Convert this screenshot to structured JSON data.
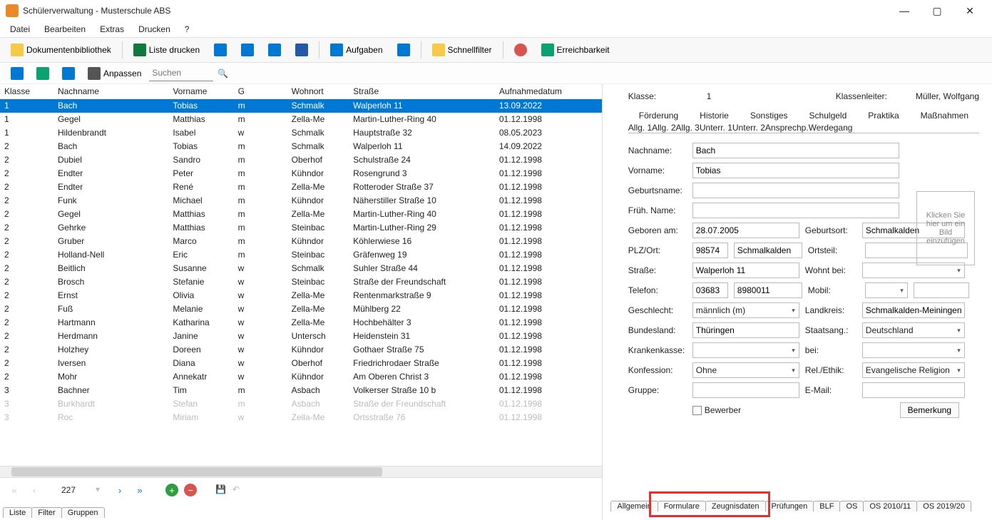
{
  "window": {
    "title": "Schülerverwaltung - Musterschule ABS"
  },
  "menu": [
    "Datei",
    "Bearbeiten",
    "Extras",
    "Drucken",
    "?"
  ],
  "toolbar": {
    "doklib": "Dokumentenbibliothek",
    "listedrucken": "Liste drucken",
    "aufgaben": "Aufgaben",
    "schnellfilter": "Schnellfilter",
    "erreichbarkeit": "Erreichbarkeit"
  },
  "subbar": {
    "anpassen": "Anpassen",
    "search_placeholder": "Suchen"
  },
  "columns": {
    "klasse": "Klasse",
    "nachname": "Nachname",
    "vorname": "Vorname",
    "g": "G",
    "wohnort": "Wohnort",
    "strasse": "Straße",
    "aufnahme": "Aufnahmedatum"
  },
  "rows": [
    {
      "k": "1",
      "n": "Bach",
      "v": "Tobias",
      "g": "m",
      "w": "Schmalk",
      "s": "Walperloh 11",
      "a": "13.09.2022",
      "sel": true
    },
    {
      "k": "1",
      "n": "Gegel",
      "v": "Matthias",
      "g": "m",
      "w": "Zella-Me",
      "s": "Martin-Luther-Ring 40",
      "a": "01.12.1998"
    },
    {
      "k": "1",
      "n": "Hildenbrandt",
      "v": "Isabel",
      "g": "w",
      "w": "Schmalk",
      "s": "Hauptstraße 32",
      "a": "08.05.2023"
    },
    {
      "k": "2",
      "n": "Bach",
      "v": "Tobias",
      "g": "m",
      "w": "Schmalk",
      "s": "Walperloh 11",
      "a": "14.09.2022"
    },
    {
      "k": "2",
      "n": "Dubiel",
      "v": "Sandro",
      "g": "m",
      "w": "Oberhof",
      "s": "Schulstraße 24",
      "a": "01.12.1998"
    },
    {
      "k": "2",
      "n": "Endter",
      "v": "Peter",
      "g": "m",
      "w": "Kühndor",
      "s": "Rosengrund 3",
      "a": "01.12.1998"
    },
    {
      "k": "2",
      "n": "Endter",
      "v": "René",
      "g": "m",
      "w": "Zella-Me",
      "s": "Rotteroder Straße 37",
      "a": "01.12.1998"
    },
    {
      "k": "2",
      "n": "Funk",
      "v": "Michael",
      "g": "m",
      "w": "Kühndor",
      "s": "Näherstiller Straße 10",
      "a": "01.12.1998"
    },
    {
      "k": "2",
      "n": "Gegel",
      "v": "Matthias",
      "g": "m",
      "w": "Zella-Me",
      "s": "Martin-Luther-Ring 40",
      "a": "01.12.1998"
    },
    {
      "k": "2",
      "n": "Gehrke",
      "v": "Matthias",
      "g": "m",
      "w": "Steinbac",
      "s": "Martin-Luther-Ring 29",
      "a": "01.12.1998"
    },
    {
      "k": "2",
      "n": "Gruber",
      "v": "Marco",
      "g": "m",
      "w": "Kühndor",
      "s": "Köhlerwiese 16",
      "a": "01.12.1998"
    },
    {
      "k": "2",
      "n": "Holland-Nell",
      "v": "Eric",
      "g": "m",
      "w": "Steinbac",
      "s": "Gräfenweg 19",
      "a": "01.12.1998"
    },
    {
      "k": "2",
      "n": "Beitlich",
      "v": "Susanne",
      "g": "w",
      "w": "Schmalk",
      "s": "Suhler Straße 44",
      "a": "01.12.1998"
    },
    {
      "k": "2",
      "n": "Brosch",
      "v": "Stefanie",
      "g": "w",
      "w": "Steinbac",
      "s": "Straße der Freundschaft",
      "a": "01.12.1998"
    },
    {
      "k": "2",
      "n": "Ernst",
      "v": "Olivia",
      "g": "w",
      "w": "Zella-Me",
      "s": "Rentenmarkstraße 9",
      "a": "01.12.1998"
    },
    {
      "k": "2",
      "n": "Fuß",
      "v": "Melanie",
      "g": "w",
      "w": "Zella-Me",
      "s": "Mühlberg 22",
      "a": "01.12.1998"
    },
    {
      "k": "2",
      "n": "Hartmann",
      "v": "Katharina",
      "g": "w",
      "w": "Zella-Me",
      "s": "Hochbehälter 3",
      "a": "01.12.1998"
    },
    {
      "k": "2",
      "n": "Herdmann",
      "v": "Janine",
      "g": "w",
      "w": "Untersch",
      "s": "Heidenstein 31",
      "a": "01.12.1998"
    },
    {
      "k": "2",
      "n": "Holzhey",
      "v": "Doreen",
      "g": "w",
      "w": "Kühndor",
      "s": "Gothaer Straße 75",
      "a": "01.12.1998"
    },
    {
      "k": "2",
      "n": "Iversen",
      "v": "Diana",
      "g": "w",
      "w": "Oberhof",
      "s": "Friedrichrodaer Straße",
      "a": "01.12.1998"
    },
    {
      "k": "2",
      "n": "Mohr",
      "v": "Annekatr",
      "g": "w",
      "w": "Kühndor",
      "s": "Am Oberen Christ 3",
      "a": "01.12.1998"
    },
    {
      "k": "3",
      "n": "Bachner",
      "v": "Tim",
      "g": "m",
      "w": "Asbach",
      "s": "Volkerser Straße 10 b",
      "a": "01.12.1998"
    },
    {
      "k": "3",
      "n": "Burkhardt",
      "v": "Stefan",
      "g": "m",
      "w": "Asbach",
      "s": "Straße der Freundschaft",
      "a": "01.12.1998",
      "faded": true
    },
    {
      "k": "3",
      "n": "Roc",
      "v": "Miriam",
      "g": "w",
      "w": "Zella-Me",
      "s": "Ortsstraße 76",
      "a": "01.12.1998",
      "faded": true
    }
  ],
  "footer": {
    "count": "227",
    "tabs": [
      "Liste",
      "Filter",
      "Gruppen"
    ]
  },
  "detail": {
    "klasse_lbl": "Klasse:",
    "klasse_val": "1",
    "klassenleiter_lbl": "Klassenleiter:",
    "klassenleiter_val": "Müller, Wolfgang",
    "top_tabs": [
      "Förderung",
      "Historie",
      "Sonstiges",
      "Schulgeld",
      "Praktika",
      "Maßnahmen"
    ],
    "sub_tabs": [
      "Allg. 1",
      "Allg. 2",
      "Allg. 3",
      "Unterr. 1",
      "Unterr. 2",
      "Ansprechp.",
      "Werdegang"
    ],
    "labels": {
      "nachname": "Nachname:",
      "vorname": "Vorname:",
      "geburtsname": "Geburtsname:",
      "fruehname": "Früh. Name:",
      "geboren": "Geboren am:",
      "geburtsort": "Geburtsort:",
      "plzort": "PLZ/Ort:",
      "ortsteil": "Ortsteil:",
      "strasse": "Straße:",
      "wohntbei": "Wohnt bei:",
      "telefon": "Telefon:",
      "mobil": "Mobil:",
      "geschlecht": "Geschlecht:",
      "landkreis": "Landkreis:",
      "bundesland": "Bundesland:",
      "staatsang": "Staatsang.:",
      "kranken": "Krankenkasse:",
      "bei": "bei:",
      "konfession": "Konfession:",
      "relethik": "Rel./Ethik:",
      "gruppe": "Gruppe:",
      "email": "E-Mail:",
      "bewerber": "Bewerber",
      "bemerkung": "Bemerkung"
    },
    "values": {
      "nachname": "Bach",
      "vorname": "Tobias",
      "geburtsname": "",
      "fruehname": "",
      "geboren": "28.07.2005",
      "geburtsort": "Schmalkalden",
      "plz": "98574",
      "ort": "Schmalkalden",
      "ortsteil": "",
      "strasse": "Walperloh 11",
      "wohntbei": "",
      "tel1": "03683",
      "tel2": "8980011",
      "mobil1": "",
      "mobil2": "",
      "geschlecht": "männlich (m)",
      "landkreis": "Schmalkalden-Meiningen",
      "bundesland": "Thüringen",
      "staatsang": "Deutschland",
      "kranken": "",
      "bei": "",
      "konfession": "Ohne",
      "relethik": "Evangelische Religion",
      "gruppe": "",
      "email": ""
    },
    "imgbox": "Klicken Sie hier um ein Bild einzufügen"
  },
  "right_tabs": [
    "Allgemein",
    "Formulare",
    "Zeugnisdaten",
    "Prüfungen",
    "BLF",
    "OS",
    "OS 2010/11",
    "OS 2019/20"
  ]
}
